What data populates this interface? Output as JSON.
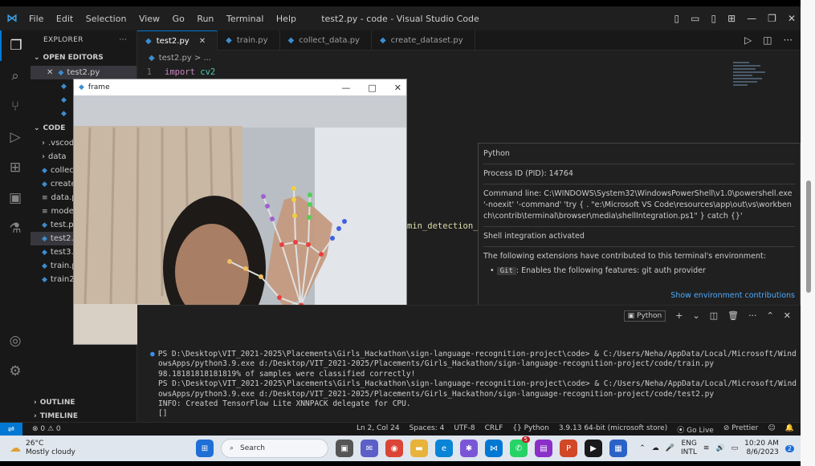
{
  "window": {
    "title": "test2.py - code - Visual Studio Code",
    "menu": [
      "File",
      "Edit",
      "Selection",
      "View",
      "Go",
      "Run",
      "Terminal",
      "Help"
    ]
  },
  "sidebar": {
    "header": "EXPLORER",
    "open_editors_label": "OPEN EDITORS",
    "open_editors": [
      "test2.py"
    ],
    "code_label": "CODE",
    "files": [
      ".vscod",
      "data",
      "collec",
      "create",
      "data.p",
      "model",
      "test.py",
      "test2.p",
      "test3.p",
      "train.p",
      "train2"
    ],
    "outline_label": "OUTLINE",
    "timeline_label": "TIMELINE"
  },
  "tabs": [
    "test2.py",
    "train.py",
    "collect_data.py",
    "create_dataset.py"
  ],
  "editor": {
    "breadcrumb": "test2.py > ...",
    "line_number": "1",
    "code_keyword": "import",
    "code_module": "cv2",
    "fragment": "min_detection_c"
  },
  "frame_window": {
    "title": "frame"
  },
  "hover": {
    "title": "Python",
    "pid": "Process ID (PID): 14764",
    "cmdline": "Command line: C:\\WINDOWS\\System32\\WindowsPowerShell\\v1.0\\powershell.exe '-noexit' '-command' 'try { . \"e:\\Microsoft VS Code\\resources\\app\\out\\vs\\workbench\\contrib\\terminal\\browser\\media\\shellIntegration.ps1\" } catch {}'",
    "shell": "Shell integration activated",
    "ext_intro": "The following extensions have contributed to this terminal's environment:",
    "ext_badge": "Git",
    "ext_text": ": Enables the following features: git auth provider",
    "link": "Show environment contributions"
  },
  "panel": {
    "terminal_tab": "Python"
  },
  "terminal": {
    "l1": "PS D:\\Desktop\\VIT_2021-2025\\Placements\\Girls_Hackathon\\sign-language-recognition-project\\code> & C:/Users/Neha/AppData/Local/Microsoft/Wind",
    "l2": "owsApps/python3.9.exe d:/Desktop/VIT_2021-2025/Placements/Girls_Hackathon/sign-language-recognition-project/code/train.py",
    "l3": "98.18181818181819% of samples were classified correctly!",
    "l4": "PS D:\\Desktop\\VIT_2021-2025\\Placements\\Girls_Hackathon\\sign-language-recognition-project\\code> & C:/Users/Neha/AppData/Local/Microsoft/Wind",
    "l5": "owsApps/python3.9.exe d:/Desktop/VIT_2021-2025/Placements/Girls_Hackathon/sign-language-recognition-project/code/test2.py",
    "l6": "INFO: Created TensorFlow Lite XNNPACK delegate for CPU.",
    "l7": "[]"
  },
  "status": {
    "problems": "⊗ 0 ⚠ 0",
    "position": "Ln 2, Col 24",
    "spaces": "Spaces: 4",
    "encoding": "UTF-8",
    "eol": "CRLF",
    "language": "{} Python",
    "interpreter": "3.9.13 64-bit (microsoft store)",
    "golive": "Go Live",
    "prettier": "Prettier"
  },
  "taskbar": {
    "temp": "26°C",
    "weather": "Mostly cloudy",
    "search": "Search",
    "lang1": "ENG",
    "lang2": "INTL",
    "time": "10:20 AM",
    "date": "8/6/2023",
    "badge": "5"
  },
  "colors": {
    "accent": "#0078d4",
    "link": "#4daafc",
    "terminal_dot": "#3b8eea"
  }
}
